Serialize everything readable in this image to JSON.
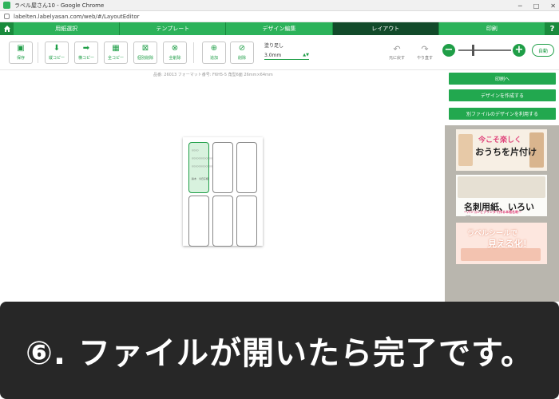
{
  "window": {
    "title": "ラベル屋さん10 - Google Chrome",
    "url": "labelten.labelyasan.com/web/#/LayoutEditor",
    "controls": [
      "─",
      "□",
      "✕"
    ]
  },
  "steps": [
    {
      "label": "用紙選択",
      "active": false
    },
    {
      "label": "テンプレート",
      "active": false
    },
    {
      "label": "デザイン編集",
      "active": false
    },
    {
      "label": "レイアウト",
      "active": true
    },
    {
      "label": "印刷",
      "active": false
    }
  ],
  "help_label": "?",
  "toolbar": {
    "buttons": [
      {
        "name": "save-button",
        "label": "保存",
        "icon": "save-icon"
      },
      {
        "name": "copy-down-button",
        "label": "縦コピー",
        "icon": "arrow-down-icon"
      },
      {
        "name": "copy-right-button",
        "label": "横コピー",
        "icon": "arrow-right-icon"
      },
      {
        "name": "copy-all-button",
        "label": "全コピー",
        "icon": "grid-icon"
      },
      {
        "name": "delete-one-button",
        "label": "個別削除",
        "icon": "delete-one-icon"
      },
      {
        "name": "delete-all-button",
        "label": "全削除",
        "icon": "delete-all-icon"
      },
      {
        "name": "add-button",
        "label": "追加",
        "icon": "add-page-icon"
      },
      {
        "name": "delete-button",
        "label": "削除",
        "icon": "delete-page-icon"
      }
    ],
    "bleed_label": "塗り足し",
    "bleed_value": "3.0mm",
    "undo_label": "元に戻す",
    "redo_label": "やり直す",
    "zoom_level": 0.25,
    "auto_label": "自動"
  },
  "canvas": {
    "info": "品番: 26013 フォーマット番号: F6H5-5 角型6面 26mm×64mm",
    "label_text": [
      "○○○○",
      "○○○○○○○○○○○○○○○",
      "○○○○○○○○○○○○○",
      "鈴木　今日子様"
    ]
  },
  "side_buttons": [
    "印刷へ",
    "デザインを作成する",
    "別ファイルのデザインを利用する"
  ],
  "banners": [
    {
      "line1": "今こそ楽しく",
      "line2": "おうちを片付け"
    },
    {
      "line1": "名刺用紙、いろいろ。",
      "line2": "〜パソコンとプリンタで作る本格名刺〜"
    },
    {
      "line1": "ラベルシールで",
      "line2": "見える化！"
    }
  ],
  "caption": "⑥. ファイルが開いたら完了です。",
  "colors": {
    "accent": "#1f9e47",
    "active_step": "#124a2a"
  }
}
